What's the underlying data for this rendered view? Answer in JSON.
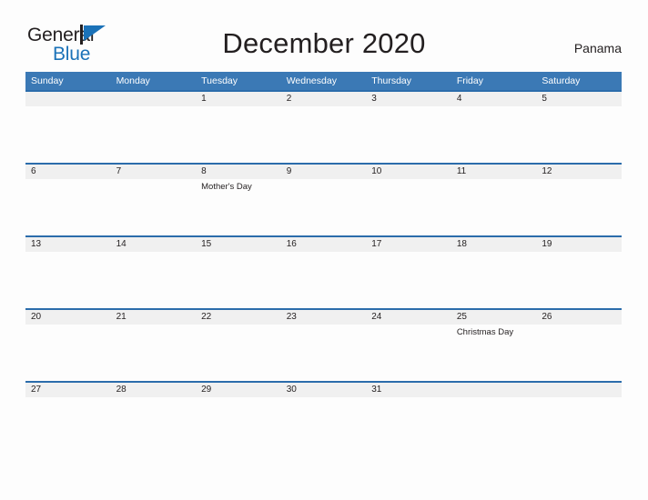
{
  "brand": {
    "name_part1": "General",
    "name_part2": "Blue",
    "flag_icon": "blue-flag-icon"
  },
  "header": {
    "title": "December 2020",
    "country": "Panama"
  },
  "calendar": {
    "month": "December",
    "year": "2020",
    "weekday_headers": [
      "Sunday",
      "Monday",
      "Tuesday",
      "Wednesday",
      "Thursday",
      "Friday",
      "Saturday"
    ],
    "accent_color": "#3b79b5",
    "rule_color": "#2b6cab",
    "band_color": "#f0f0f0",
    "weeks": [
      [
        {
          "day": "",
          "events": []
        },
        {
          "day": "",
          "events": []
        },
        {
          "day": "1",
          "events": []
        },
        {
          "day": "2",
          "events": []
        },
        {
          "day": "3",
          "events": []
        },
        {
          "day": "4",
          "events": []
        },
        {
          "day": "5",
          "events": []
        }
      ],
      [
        {
          "day": "6",
          "events": []
        },
        {
          "day": "7",
          "events": []
        },
        {
          "day": "8",
          "events": [
            "Mother's Day"
          ]
        },
        {
          "day": "9",
          "events": []
        },
        {
          "day": "10",
          "events": []
        },
        {
          "day": "11",
          "events": []
        },
        {
          "day": "12",
          "events": []
        }
      ],
      [
        {
          "day": "13",
          "events": []
        },
        {
          "day": "14",
          "events": []
        },
        {
          "day": "15",
          "events": []
        },
        {
          "day": "16",
          "events": []
        },
        {
          "day": "17",
          "events": []
        },
        {
          "day": "18",
          "events": []
        },
        {
          "day": "19",
          "events": []
        }
      ],
      [
        {
          "day": "20",
          "events": []
        },
        {
          "day": "21",
          "events": []
        },
        {
          "day": "22",
          "events": []
        },
        {
          "day": "23",
          "events": []
        },
        {
          "day": "24",
          "events": []
        },
        {
          "day": "25",
          "events": [
            "Christmas Day"
          ]
        },
        {
          "day": "26",
          "events": []
        }
      ],
      [
        {
          "day": "27",
          "events": []
        },
        {
          "day": "28",
          "events": []
        },
        {
          "day": "29",
          "events": []
        },
        {
          "day": "30",
          "events": []
        },
        {
          "day": "31",
          "events": []
        },
        {
          "day": "",
          "events": []
        },
        {
          "day": "",
          "events": []
        }
      ]
    ]
  }
}
